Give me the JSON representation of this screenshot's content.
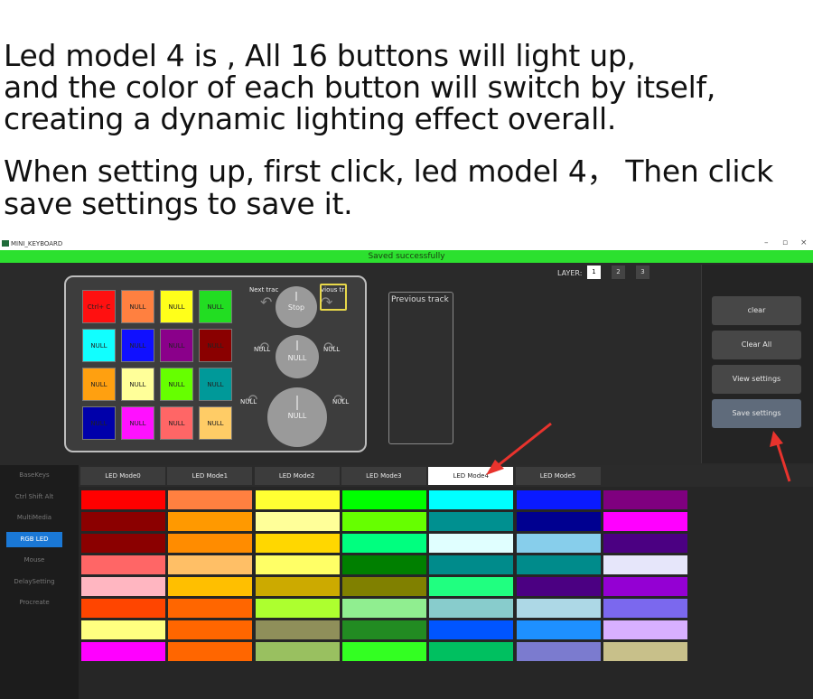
{
  "caption": {
    "line1": "Led model 4 is , All 16 buttons will light up,",
    "line2": "and the color of each button will switch by itself,",
    "line3": "creating a dynamic lighting effect overall.",
    "line4": "When setting up, first click, led model 4，  Then click",
    "line5": "save settings to save it."
  },
  "window": {
    "title": "MINI_KEYBOARD",
    "min": "–",
    "restore": "▫",
    "close": "×"
  },
  "status": "Saved successfully",
  "layer": {
    "label": "LAYER:",
    "buttons": [
      "1",
      "2",
      "3"
    ],
    "active": 0
  },
  "keys": [
    {
      "label": "Ctrl+ C",
      "color": "#ff1010"
    },
    {
      "label": "NULL",
      "color": "#ff8040"
    },
    {
      "label": "NULL",
      "color": "#ffff1a"
    },
    {
      "label": "NULL",
      "color": "#22dd22"
    },
    {
      "label": "NULL",
      "color": "#11ffff"
    },
    {
      "label": "NULL",
      "color": "#1010ff"
    },
    {
      "label": "NULL",
      "color": "#8a008a"
    },
    {
      "label": "NULL",
      "color": "#8a0000"
    },
    {
      "label": "NULL",
      "color": "#ffa010"
    },
    {
      "label": "NULL",
      "color": "#ffff99"
    },
    {
      "label": "NULL",
      "color": "#66ff00"
    },
    {
      "label": "NULL",
      "color": "#009999"
    },
    {
      "label": "NULL",
      "color": "#0000aa"
    },
    {
      "label": "NULL",
      "color": "#ff11ff"
    },
    {
      "label": "NULL",
      "color": "#ff6666"
    },
    {
      "label": "NULL",
      "color": "#ffcc66"
    }
  ],
  "knobs": {
    "k1": {
      "center": "Stop",
      "left": "Next trac",
      "right": "vious tr"
    },
    "k2": {
      "center": "NULL",
      "left": "NULL",
      "right": "NULL"
    },
    "k3": {
      "center": "NULL",
      "left": "NULL",
      "right": "NULL"
    }
  },
  "preview": "Previous track",
  "right_buttons": [
    "clear",
    "Clear All",
    "View settings",
    "Save settings"
  ],
  "sidebar": [
    "BaseKeys",
    "Ctrl Shift Alt",
    "MultiMedia",
    "RGB LED",
    "Mouse",
    "DelaySetting",
    "Procreate"
  ],
  "sidebar_active": 3,
  "led_tabs": [
    "LED Mode0",
    "LED Mode1",
    "LED Mode2",
    "LED Mode3",
    "LED Mode4",
    "LED Mode5"
  ],
  "led_tab_active": 4,
  "color_grid": [
    [
      "#ff0000",
      "#ff8040",
      "#ffff33",
      "#00ff00",
      "#00ffff",
      "#0a1aff",
      "#7f007f"
    ],
    [
      "#8b0000",
      "#ff9900",
      "#ffff99",
      "#66ff00",
      "#009090",
      "#000090",
      "#ff00ff"
    ],
    [
      "#8b0000",
      "#ff8c00",
      "#ffd700",
      "#00ff7f",
      "#e0ffff",
      "#87ceeb",
      "#4b0082"
    ],
    [
      "#ff6666",
      "#ffbf66",
      "#ffff66",
      "#007f00",
      "#008b8b",
      "#008b8b",
      "#e6e6fa"
    ],
    [
      "#ffb6c1",
      "#ffbf00",
      "#ccaa00",
      "#808000",
      "#20ff80",
      "#4b0082",
      "#9400d3"
    ],
    [
      "#ff4500",
      "#ff6600",
      "#adff2f",
      "#90ee90",
      "#88cccc",
      "#add8e6",
      "#7b68ee"
    ],
    [
      "#ffff80",
      "#ff6600",
      "#8f8f5a",
      "#228b22",
      "#0055ff",
      "#1e90ff",
      "#d8b0ff"
    ],
    [
      "#ff00ff",
      "#ff6600",
      "#99c060",
      "#33ff22",
      "#00c060",
      "#7b7bcf",
      "#c8c08a"
    ]
  ]
}
